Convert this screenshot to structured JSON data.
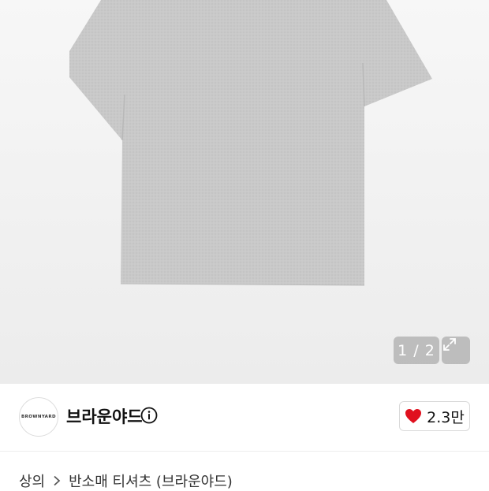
{
  "gallery": {
    "counter": "1 / 2",
    "expand_icon": "expand-icon"
  },
  "brand": {
    "logo_text": "BROWNYARD",
    "name": "브라운야드",
    "info_icon": "info-icon"
  },
  "like": {
    "icon": "heart-icon",
    "count": "2.3만",
    "heart_color": "#e0101e"
  },
  "breadcrumb": {
    "category": "상의",
    "separator_icon": "chevron-right-icon",
    "product": "반소매 티셔츠 (브라운야드)"
  }
}
